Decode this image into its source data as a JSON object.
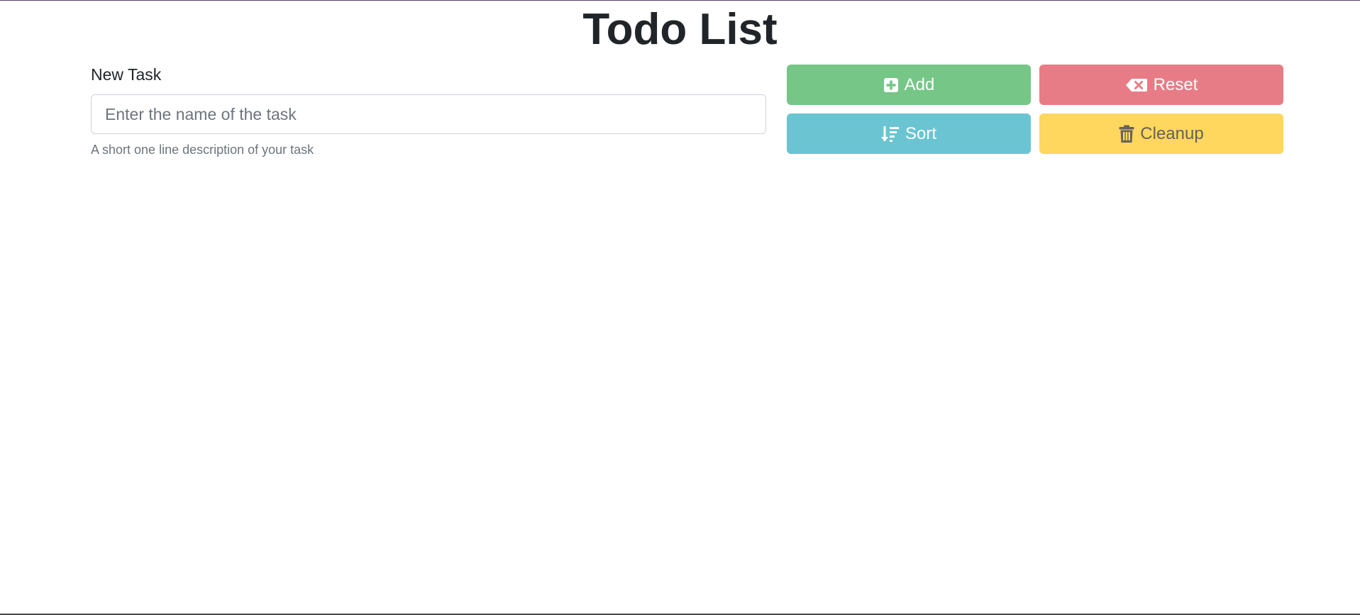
{
  "header": {
    "title": "Todo List"
  },
  "form": {
    "label": "New Task",
    "placeholder": "Enter the name of the task",
    "value": "",
    "help": "A short one line description of your task"
  },
  "buttons": {
    "add": {
      "label": "Add",
      "icon": "plus-square-icon",
      "color": "#75c687"
    },
    "reset": {
      "label": "Reset",
      "icon": "backspace-icon",
      "color": "#e87c86"
    },
    "sort": {
      "label": "Sort",
      "icon": "sort-down-icon",
      "color": "#6bc4d2"
    },
    "cleanup": {
      "label": "Cleanup",
      "icon": "trash-icon",
      "color": "#ffd75f"
    }
  }
}
